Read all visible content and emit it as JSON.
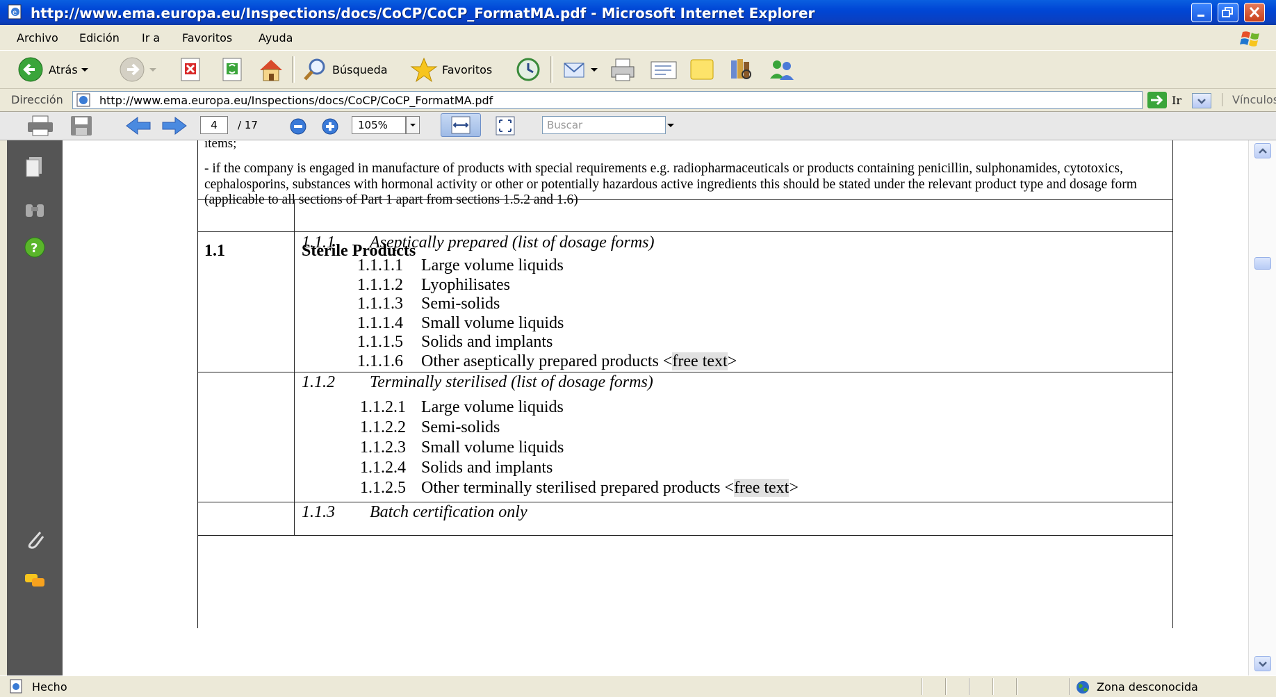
{
  "window": {
    "title": "http://www.ema.europa.eu/Inspections/docs/CoCP/CoCP_FormatMA.pdf - Microsoft Internet Explorer"
  },
  "menu": [
    "Archivo",
    "Edición",
    "Ir a",
    "Favoritos",
    "Ayuda"
  ],
  "toolbar": {
    "back_label": "Atrás",
    "search_label": "Búsqueda",
    "favorites_label": "Favoritos"
  },
  "address": {
    "label": "Dirección",
    "url": "http://www.ema.europa.eu/Inspections/docs/CoCP/CoCP_FormatMA.pdf",
    "go_label": "Ir",
    "links_label": "Vínculos"
  },
  "pdf_toolbar": {
    "page_current": "4",
    "page_total": "/ 17",
    "zoom": "105%",
    "search_placeholder": "Buscar"
  },
  "document": {
    "intro_line": "items;",
    "paragraph": "- if the company is engaged in manufacture of products with special requirements e.g. radiopharmaceuticals or products containing penicillin, sulphonamides, cytotoxics, cephalosporins, substances with hormonal activity or other or potentially hazardous active ingredients this should be stated under the relevant product type and dosage form (applicable to all sections of Part 1 apart from sections 1.5.2 and 1.6)",
    "section": {
      "number": "1.1",
      "title": "Sterile Products"
    },
    "sub1": {
      "number": "1.1.1",
      "title": "Aseptically prepared (list of dosage forms)",
      "items": [
        {
          "code": "1.1.1.1",
          "text": "Large volume liquids"
        },
        {
          "code": "1.1.1.2",
          "text": "Lyophilisates"
        },
        {
          "code": "1.1.1.3",
          "text": "Semi-solids"
        },
        {
          "code": "1.1.1.4",
          "text": "Small volume liquids"
        },
        {
          "code": "1.1.1.5",
          "text": "Solids and implants"
        },
        {
          "code": "1.1.1.6",
          "text": "Other aseptically prepared products <",
          "highlight": "free text",
          "suffix": ">"
        }
      ]
    },
    "sub2": {
      "number": "1.1.2",
      "title": "Terminally sterilised (list of dosage forms)",
      "items": [
        {
          "code": "1.1.2.1",
          "text": "Large volume liquids"
        },
        {
          "code": "1.1.2.2",
          "text": "Semi-solids"
        },
        {
          "code": "1.1.2.3",
          "text": "Small volume liquids"
        },
        {
          "code": "1.1.2.4",
          "text": "Solids and implants"
        },
        {
          "code": "1.1.2.5",
          "text": "Other terminally sterilised prepared products <",
          "highlight": "free text",
          "suffix": ">"
        }
      ]
    },
    "sub3": {
      "number": "1.1.3",
      "title": "Batch certification only"
    }
  },
  "status": {
    "text": "Hecho",
    "zone": "Zona desconocida"
  }
}
